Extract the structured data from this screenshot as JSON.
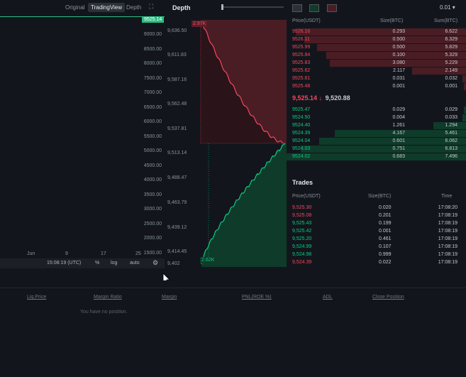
{
  "chart": {
    "tabs": [
      "Original",
      "TradingView",
      "Depth"
    ],
    "active_tab": "TradingView",
    "current_price": "9525.14",
    "price_ticks": [
      "9000.00",
      "8500.00",
      "8000.00",
      "7500.00",
      "7000.00",
      "6500.00",
      "6000.00",
      "5500.00",
      "5000.00",
      "4500.00",
      "4000.00",
      "3500.00",
      "3000.00",
      "2500.00",
      "2000.00",
      "1500.00"
    ],
    "date_ticks": [
      "Jun",
      "9",
      "17",
      "25"
    ],
    "bottom_bar": {
      "time": "15:08:19 (UTC)",
      "percent": "%",
      "log": "log",
      "auto": "auto"
    }
  },
  "depth": {
    "title": "Depth",
    "price_ticks": [
      "9,636.50",
      "9,611.83",
      "9,587.16",
      "9,562.48",
      "9,537.81",
      "9,513.14",
      "9,488.47",
      "9,463.79",
      "9,439.12",
      "9,414.45",
      "9,402"
    ],
    "ask_label": "2.97K",
    "bid_label": "2.62K",
    "colors": {
      "ask": "#f6465d",
      "bid": "#0ecb81",
      "ask_fill": "#4a1d25",
      "bid_fill": "#0f3b2a"
    }
  },
  "orderbook": {
    "precision": "0.01",
    "headers": {
      "price": "Price(USDT)",
      "size": "Size(BTC)",
      "sum": "Sum(BTC)"
    },
    "asks": [
      {
        "price": "9526.16",
        "size": "0.293",
        "sum": "6.622",
        "depth": 0.95
      },
      {
        "price": "9526.11",
        "size": "0.500",
        "sum": "6.329",
        "depth": 0.9
      },
      {
        "price": "9525.99",
        "size": "0.500",
        "sum": "5.829",
        "depth": 0.83
      },
      {
        "price": "9525.84",
        "size": "0.100",
        "sum": "5.329",
        "depth": 0.78
      },
      {
        "price": "9525.83",
        "size": "3.080",
        "sum": "5.229",
        "depth": 0.76
      },
      {
        "price": "9525.62",
        "size": "2.117",
        "sum": "2.149",
        "depth": 0.3
      },
      {
        "price": "9525.61",
        "size": "0.031",
        "sum": "0.032",
        "depth": 0.02
      },
      {
        "price": "9525.48",
        "size": "0.001",
        "sum": "0.001",
        "depth": 0.01
      }
    ],
    "last_price": "9,525.14",
    "arrow": "↓",
    "mark_price": "9,520.88",
    "bids": [
      {
        "price": "9525.47",
        "size": "0.029",
        "sum": "0.029",
        "depth": 0.01
      },
      {
        "price": "9524.50",
        "size": "0.004",
        "sum": "0.033",
        "depth": 0.02
      },
      {
        "price": "9524.40",
        "size": "1.261",
        "sum": "1.294",
        "depth": 0.18
      },
      {
        "price": "9524.39",
        "size": "4.167",
        "sum": "5.461",
        "depth": 0.73
      },
      {
        "price": "9524.04",
        "size": "0.601",
        "sum": "6.062",
        "depth": 0.82
      },
      {
        "price": "9524.03",
        "size": "0.751",
        "sum": "6.813",
        "depth": 0.92
      },
      {
        "price": "9524.02",
        "size": "0.683",
        "sum": "7.496",
        "depth": 1.0
      }
    ]
  },
  "trades": {
    "title": "Trades",
    "headers": {
      "price": "Price(USDT)",
      "size": "Size(BTC)",
      "time": "Time"
    },
    "rows": [
      {
        "price": "9,525.30",
        "size": "0.020",
        "time": "17:08:20",
        "side": "sell"
      },
      {
        "price": "9,525.08",
        "size": "0.201",
        "time": "17:08:19",
        "side": "sell"
      },
      {
        "price": "9,525.43",
        "size": "0.199",
        "time": "17:08:19",
        "side": "buy"
      },
      {
        "price": "9,525.42",
        "size": "0.001",
        "time": "17:08:19",
        "side": "buy"
      },
      {
        "price": "9,525.20",
        "size": "0.461",
        "time": "17:08:19",
        "side": "buy"
      },
      {
        "price": "9,524.99",
        "size": "0.107",
        "time": "17:08:19",
        "side": "buy"
      },
      {
        "price": "9,524.98",
        "size": "0.999",
        "time": "17:08:19",
        "side": "buy"
      },
      {
        "price": "9,524.39",
        "size": "0.022",
        "time": "17:08:19",
        "side": "sell"
      }
    ]
  },
  "positions": {
    "columns": [
      "Liq.Price",
      "Margin Ratio",
      "Margin",
      "PNL(ROE %)",
      "ADL",
      "Close Position"
    ],
    "empty": "You have no position."
  }
}
